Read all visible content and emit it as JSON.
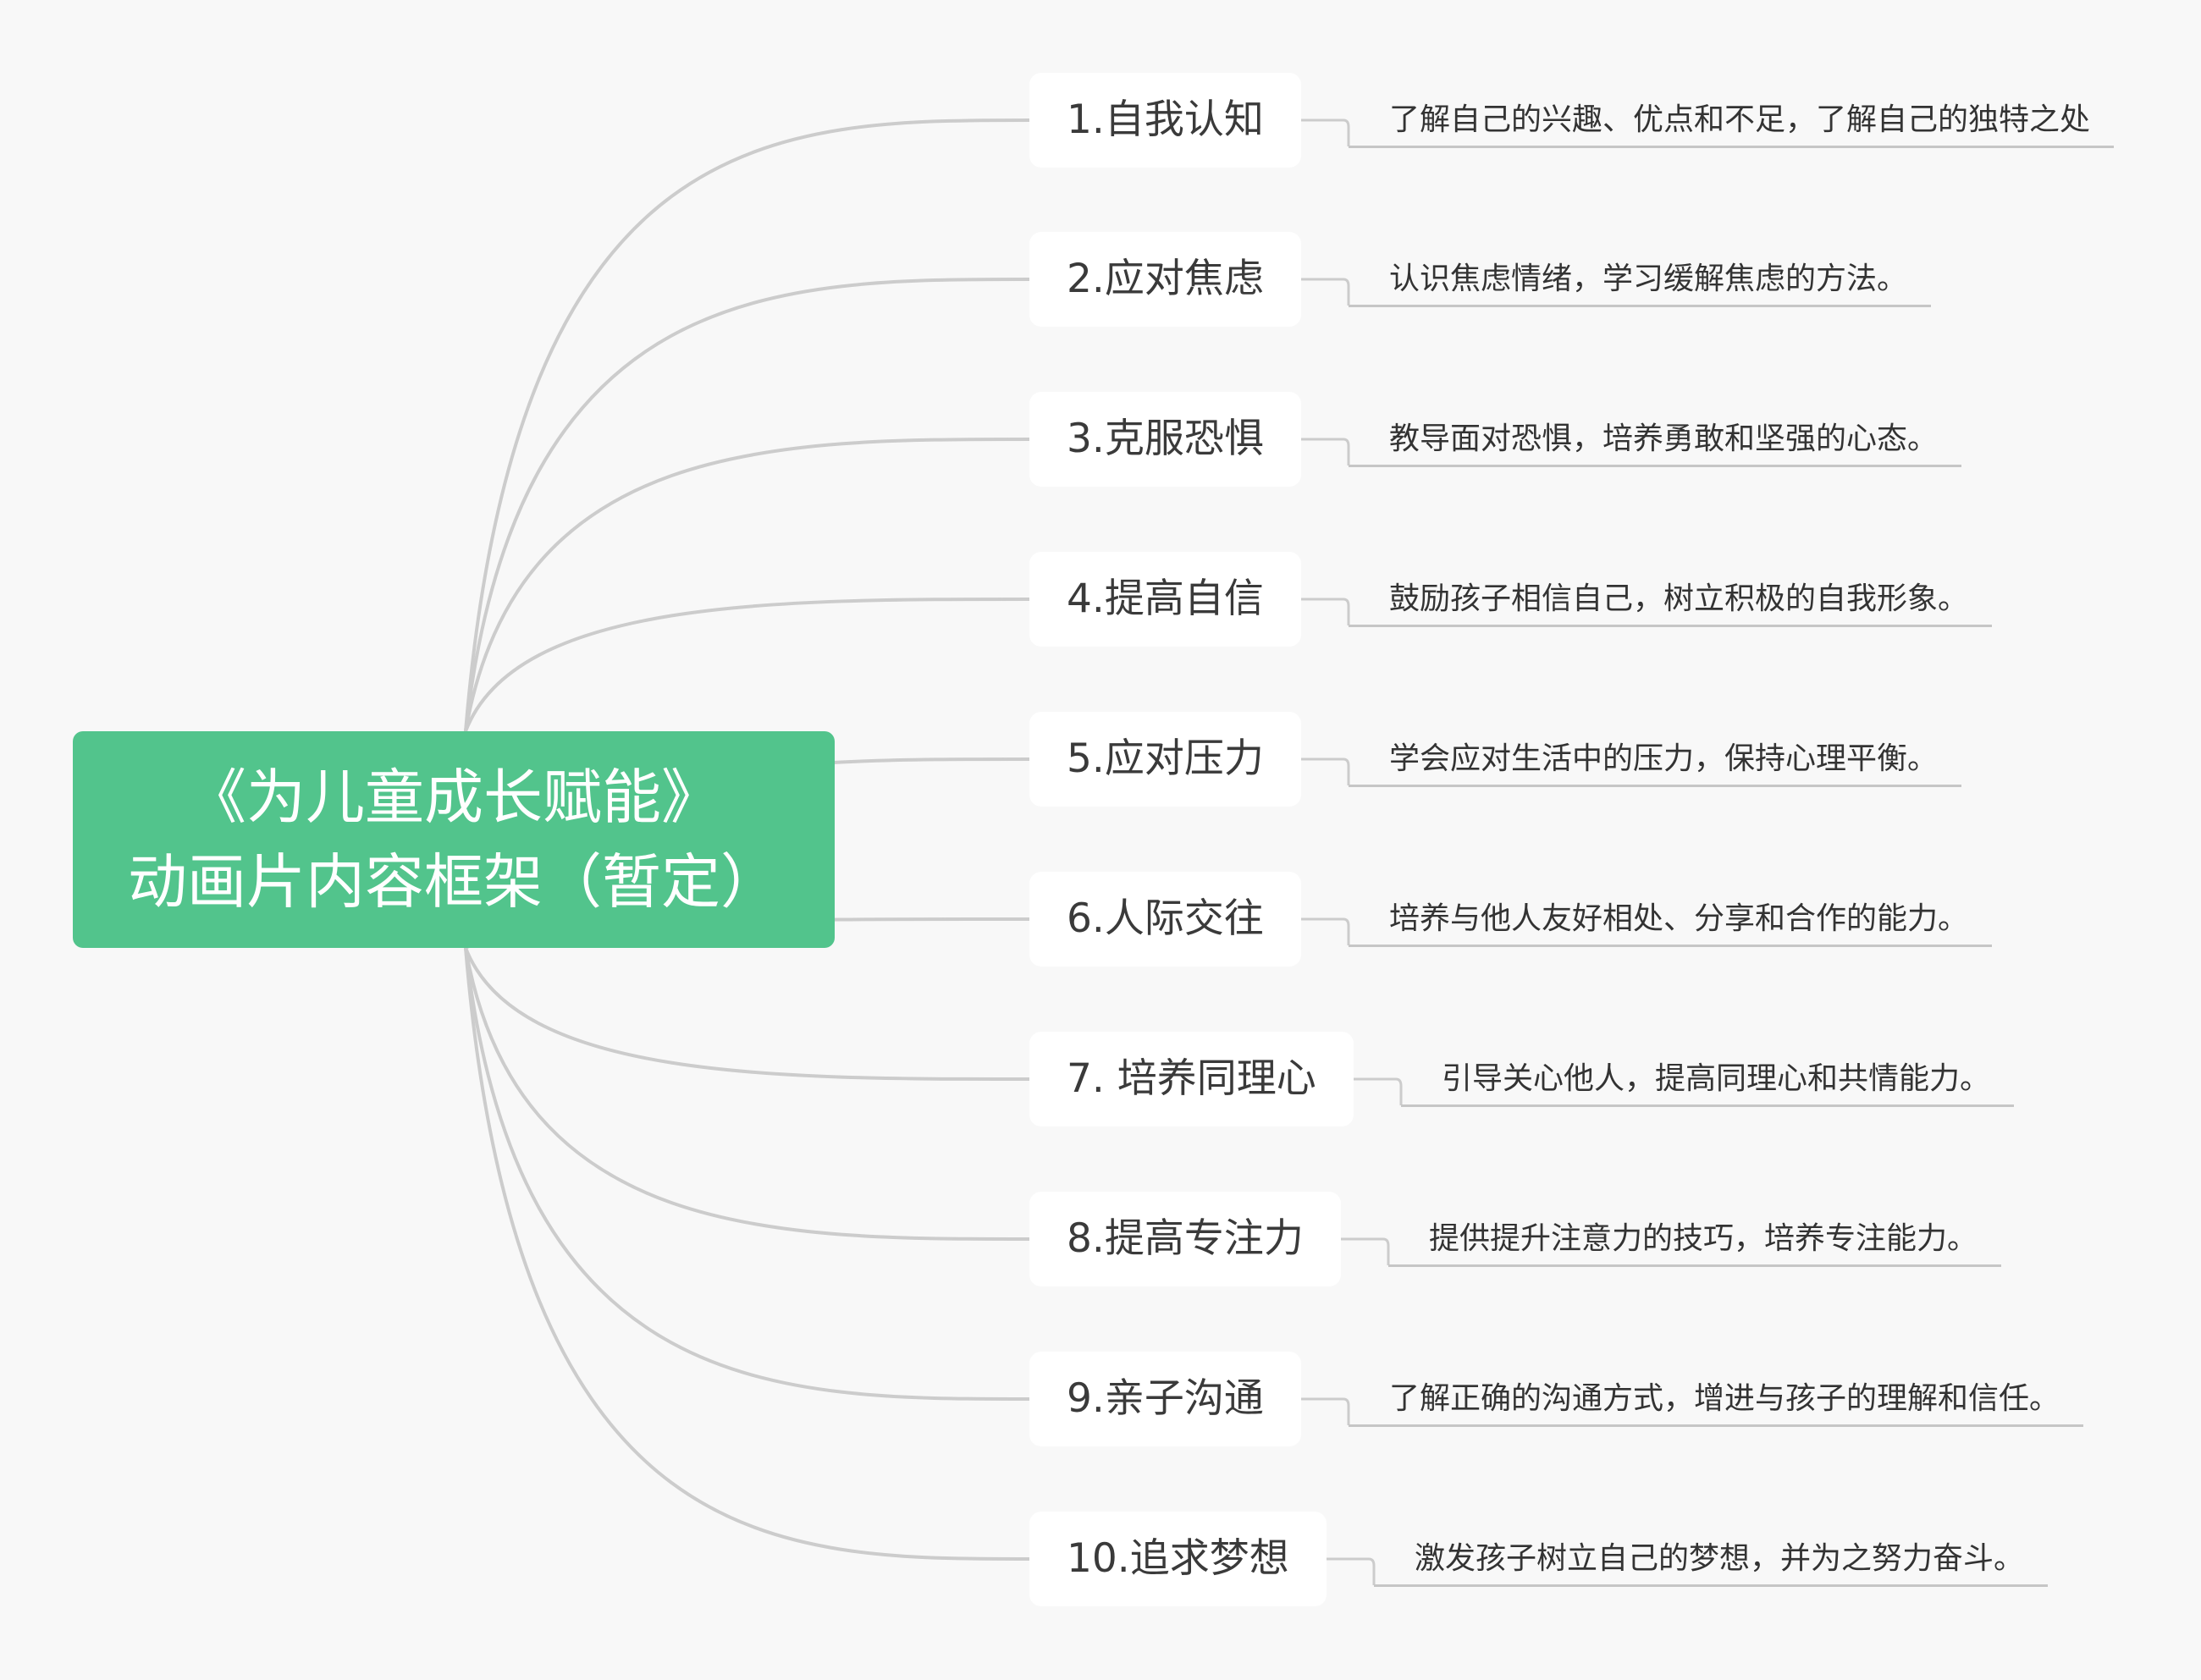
{
  "colors": {
    "background": "#f8f8f8",
    "root": "#52c48c",
    "line": "#cccccc",
    "topic_bg": "#ffffff"
  },
  "root": {
    "title_line1": "《为儿童成长赋能》",
    "title_line2": "动画片内容框架（暂定）"
  },
  "topics": [
    {
      "label": "1.自我认知",
      "detail": "了解自己的兴趣、优点和不足，了解自己的独特之处"
    },
    {
      "label": "2.应对焦虑",
      "detail": "认识焦虑情绪，学习缓解焦虑的方法。"
    },
    {
      "label": "3.克服恐惧",
      "detail": "教导面对恐惧，培养勇敢和坚强的心态。"
    },
    {
      "label": "4.提高自信",
      "detail": "鼓励孩子相信自己，树立积极的自我形象。"
    },
    {
      "label": "5.应对压力",
      "detail": "学会应对生活中的压力，保持心理平衡。"
    },
    {
      "label": "6.人际交往",
      "detail": "培养与他人友好相处、分享和合作的能力。"
    },
    {
      "label": "7. 培养同理心",
      "detail": "引导关心他人，提高同理心和共情能力。"
    },
    {
      "label": "8.提高专注力",
      "detail": "提供提升注意力的技巧，培养专注能力。"
    },
    {
      "label": "9.亲子沟通",
      "detail": "了解正确的沟通方式，增进与孩子的理解和信任。"
    },
    {
      "label": "10.追求梦想",
      "detail": "激发孩子树立自己的梦想，并为之努力奋斗。"
    }
  ]
}
